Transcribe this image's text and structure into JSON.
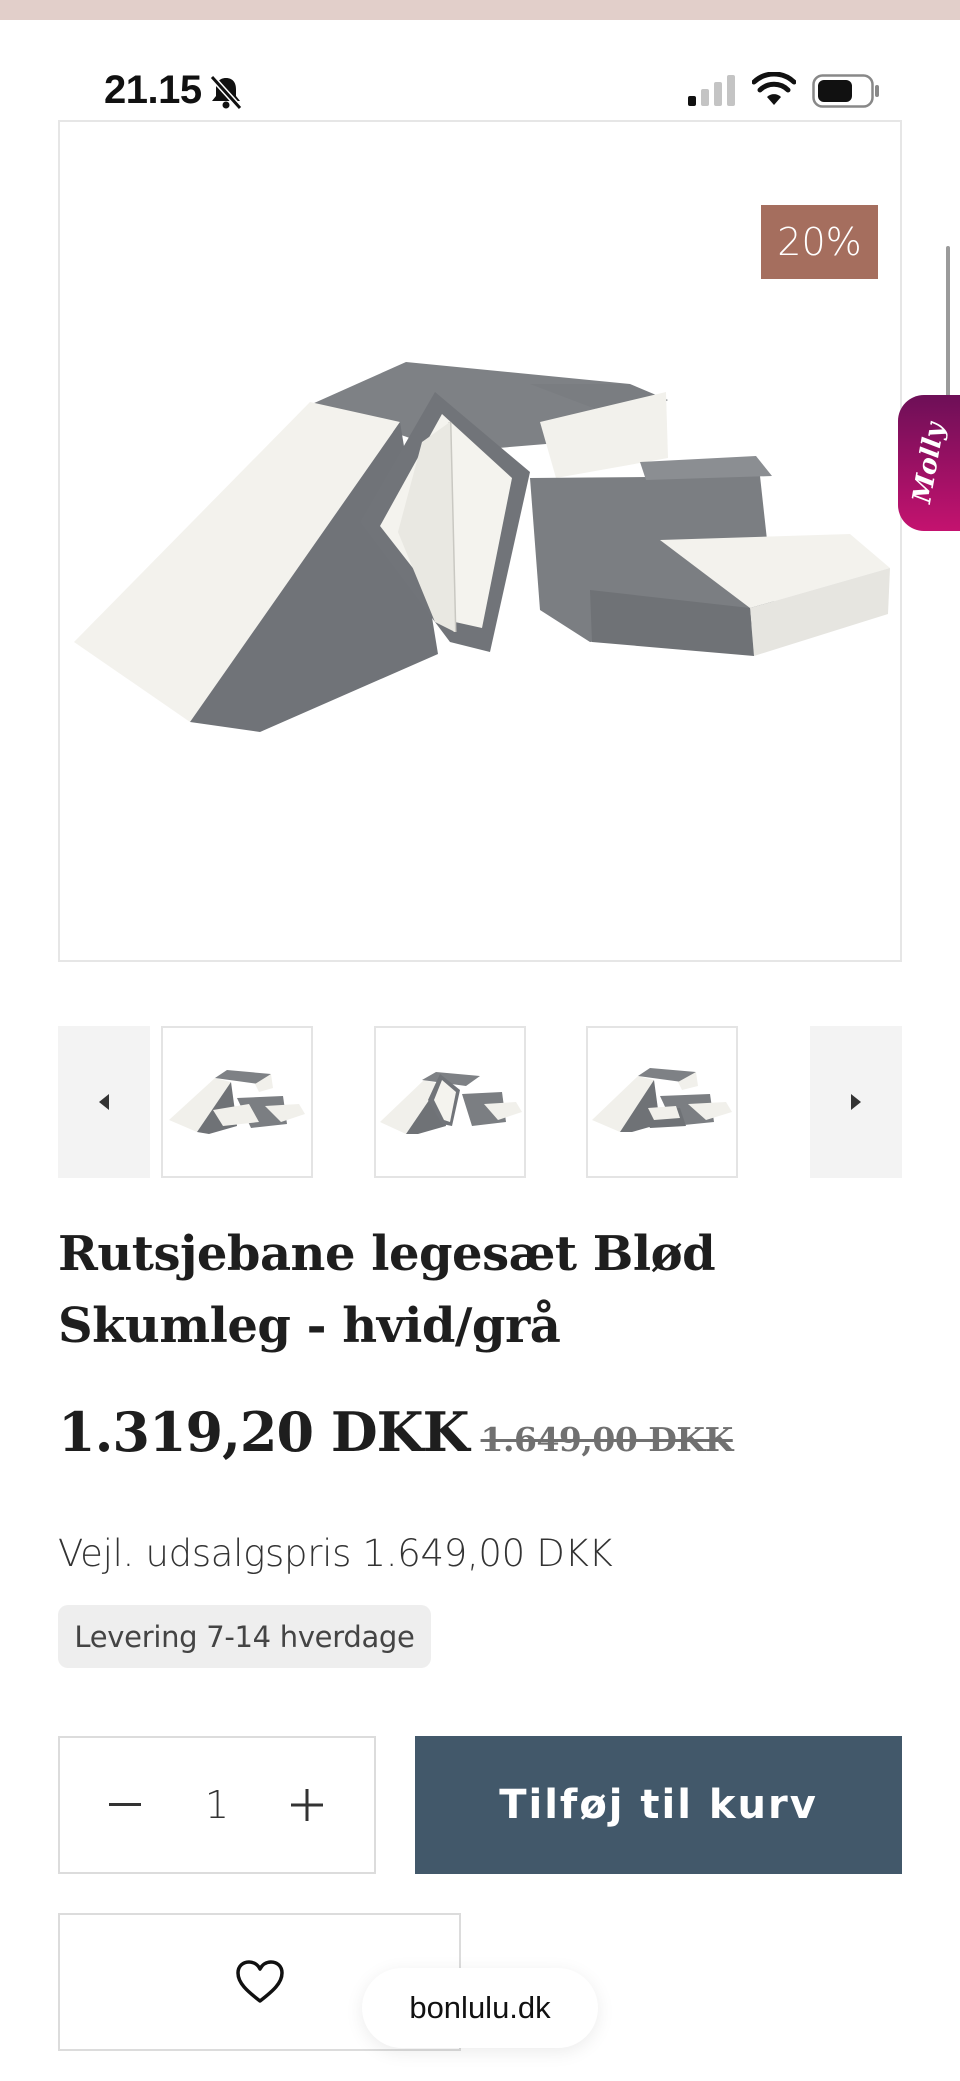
{
  "status_bar": {
    "time": "21.15",
    "icons": [
      "bell-off-icon",
      "cellular-signal-icon",
      "wifi-icon",
      "battery-icon"
    ]
  },
  "product_gallery": {
    "discount_badge": "20%",
    "thumbnails": [
      "product-photo-1",
      "product-photo-2",
      "product-photo-3"
    ],
    "prev_icon": "caret-left-icon",
    "next_icon": "caret-right-icon"
  },
  "side_widget": {
    "label": "Molly",
    "color_start": "#6d0f57",
    "color_end": "#c4126f"
  },
  "product": {
    "title": "Rutsjebane legesæt Blød Skumleg - hvid/grå",
    "price_current": "1.319,20 DKK",
    "price_old": "1.649,00 DKK",
    "rrp_text": "Vejl. udsalgspris 1.649,00 DKK",
    "delivery": "Levering 7-14 hverdage"
  },
  "purchase": {
    "quantity": "1",
    "add_to_cart_label": "Tilføj til kurv",
    "wishlist_icon": "heart-icon"
  },
  "browser": {
    "url": "bonlulu.dk"
  },
  "colors": {
    "discount_badge": "#a56e5e",
    "add_to_cart": "#42586a",
    "top_strip": "#e2cfca"
  }
}
